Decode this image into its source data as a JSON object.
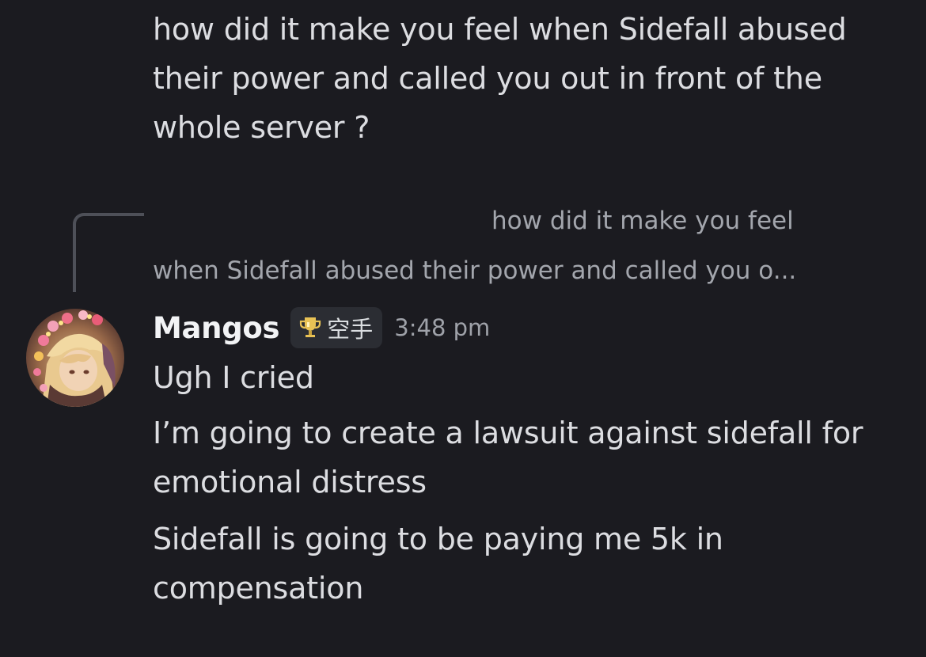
{
  "previous_message": {
    "text": "how did it make you feel when Sidefall abused their power and called you out in front of the whole server ?"
  },
  "reply_preview": {
    "text_line1": "how did it make you feel",
    "text_line2": "when Sidefall abused their power and called you o..."
  },
  "message_group": {
    "author": "Mangos",
    "tag": {
      "icon": "trophy-icon",
      "label": "空手"
    },
    "timestamp": "3:48 pm",
    "messages": [
      "Ugh I cried",
      "I’m going to create a lawsuit against sidefall for emotional distress",
      "Sidefall is going to be paying me 5k in compensation"
    ]
  },
  "colors": {
    "background": "#1b1b20",
    "message_text": "#dcdde1",
    "username": "#f2f3f5",
    "muted_text": "#a3a6ad",
    "tag_background": "#2b2d33",
    "trophy_gold": "#e8c255"
  }
}
